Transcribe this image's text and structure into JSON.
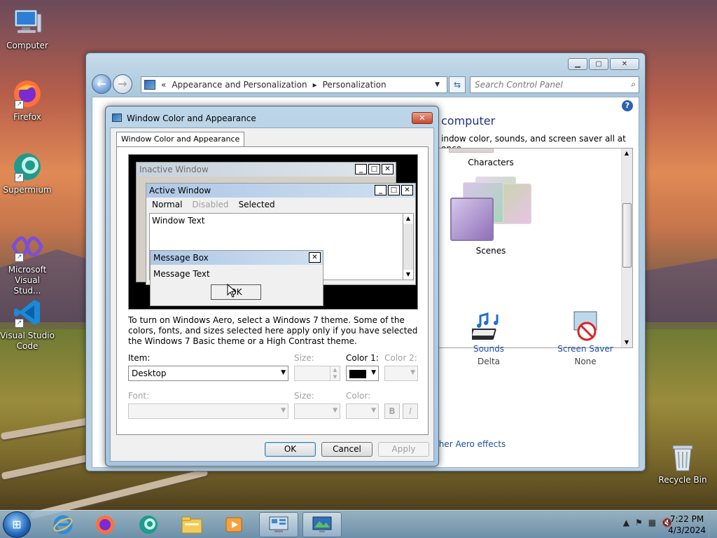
{
  "desktop": {
    "icons": [
      {
        "label": "Computer",
        "icon": "computer-icon"
      },
      {
        "label": "Firefox",
        "icon": "firefox-icon"
      },
      {
        "label": "Supermium",
        "icon": "supermium-icon"
      },
      {
        "label": "Microsoft Visual Stud...",
        "icon": "visual-studio-icon"
      },
      {
        "label": "Visual Studio Code",
        "icon": "vscode-icon"
      },
      {
        "label": "Recycle Bin",
        "icon": "recycle-bin-icon"
      }
    ]
  },
  "control_panel": {
    "breadcrumb": [
      "Appearance and Personalization",
      "Personalization"
    ],
    "breadcrumb_prefix": "«",
    "search_placeholder": "Search Control Panel",
    "heading": "computer",
    "subheading": "indow color, sounds, and screen saver all at once.",
    "themes": [
      {
        "label": "Characters"
      },
      {
        "label": "Scenes"
      }
    ],
    "bottom_items": [
      {
        "label": "Sounds",
        "sub": "Delta",
        "icon": "sounds-icon"
      },
      {
        "label": "Screen Saver",
        "sub": "None",
        "icon": "screen-saver-icon"
      }
    ],
    "aero_link": "ther Aero effects"
  },
  "dialog": {
    "title": "Window Color and Appearance",
    "tab": "Window Color and Appearance",
    "preview": {
      "inactive_title": "Inactive Window",
      "active_title": "Active Window",
      "menu": [
        "Normal",
        "Disabled",
        "Selected"
      ],
      "window_text": "Window Text",
      "msgbox_title": "Message Box",
      "msgbox_text": "Message Text",
      "ok": "OK"
    },
    "description": "To turn on Windows Aero, select a Windows 7 theme.  Some of the colors, fonts, and sizes selected here apply only if you have selected the Windows 7 Basic theme or a High Contrast theme.",
    "item_label": "Item:",
    "item_value": "Desktop",
    "size_label": "Size:",
    "color1_label": "Color 1:",
    "color1_value": "#000000",
    "color2_label": "Color 2:",
    "font_label": "Font:",
    "font_size_label": "Size:",
    "color_label": "Color:",
    "bold": "B",
    "italic": "I",
    "buttons": {
      "ok": "OK",
      "cancel": "Cancel",
      "apply": "Apply"
    }
  },
  "taskbar": {
    "time": "7:22 PM",
    "date": "4/3/2024",
    "apps": [
      "ie-icon",
      "firefox-icon",
      "supermium-icon",
      "explorer-icon",
      "media-player-icon",
      "control-panel-icon",
      "display-icon"
    ]
  }
}
